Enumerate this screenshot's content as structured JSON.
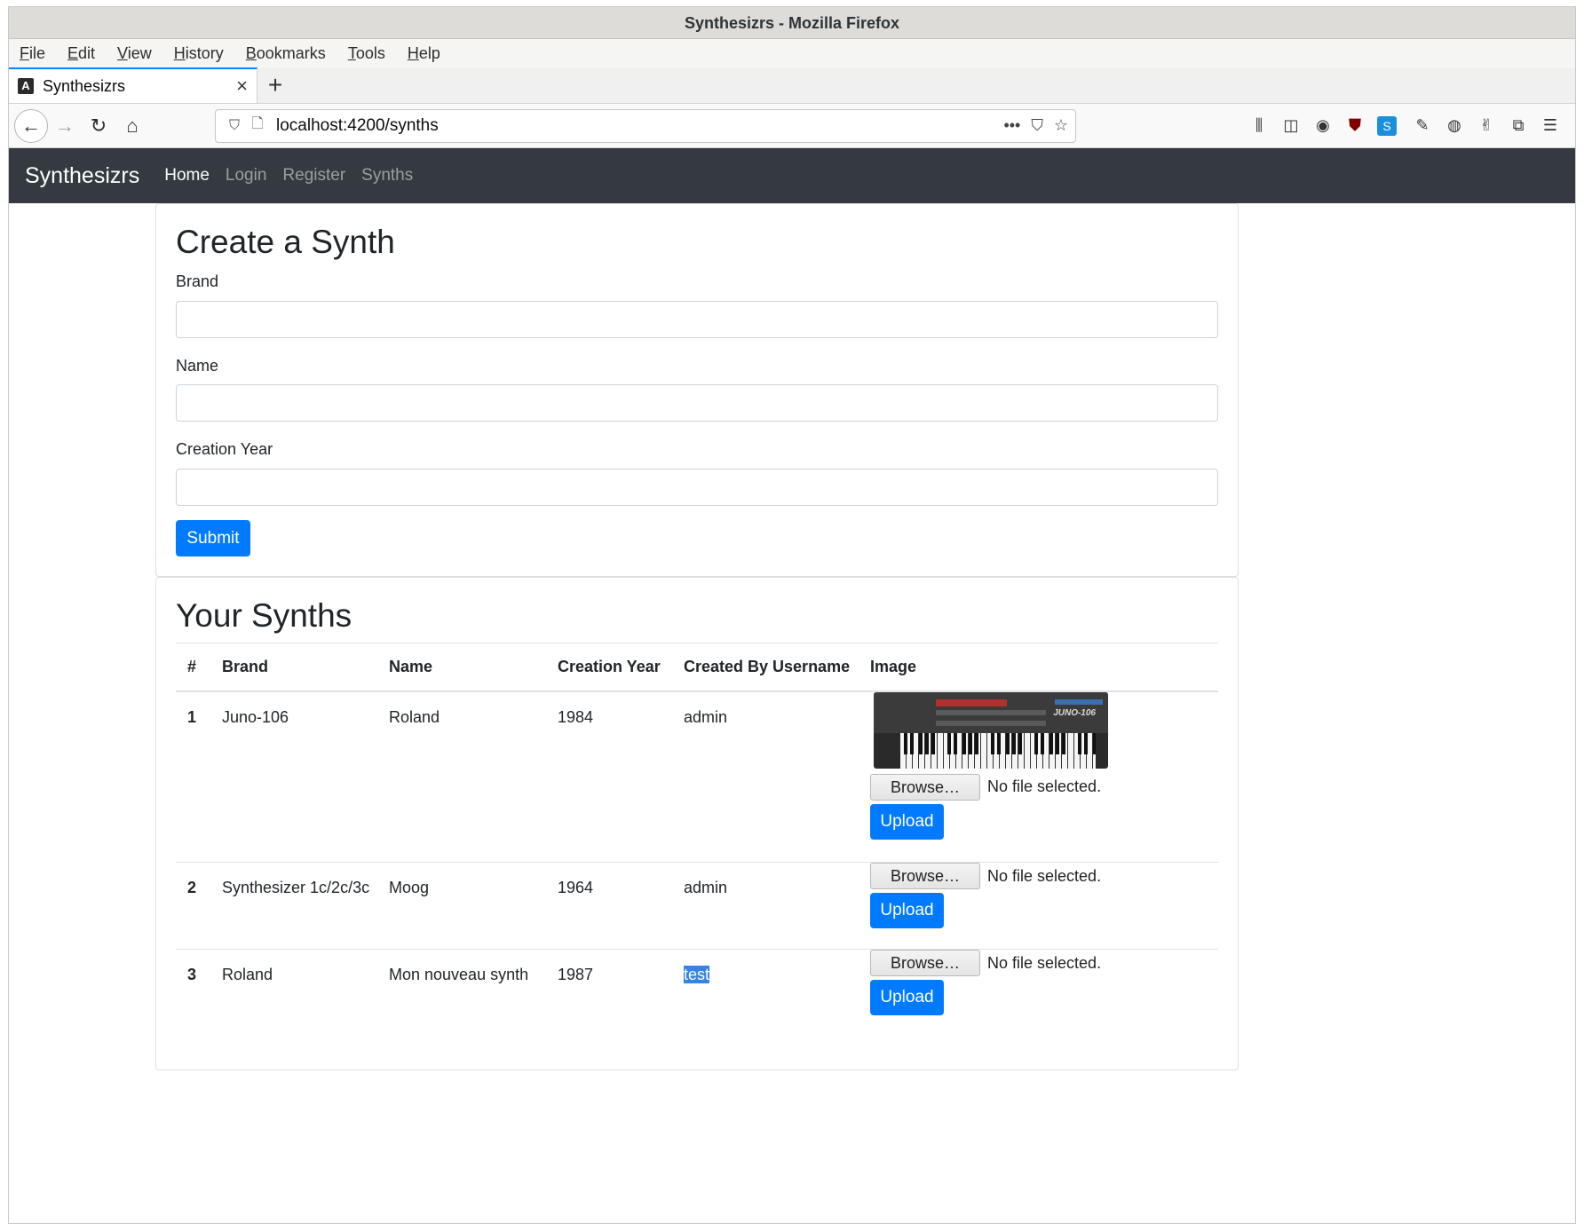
{
  "window": {
    "title": "Synthesizrs - Mozilla Firefox"
  },
  "menu": [
    {
      "label": "File",
      "accel": "F",
      "rest": "ile"
    },
    {
      "label": "Edit",
      "accel": "E",
      "rest": "dit"
    },
    {
      "label": "View",
      "accel": "V",
      "rest": "iew"
    },
    {
      "label": "History",
      "accel": "H",
      "rest": "istory"
    },
    {
      "label": "Bookmarks",
      "accel": "B",
      "rest": "ookmarks"
    },
    {
      "label": "Tools",
      "accel": "T",
      "rest": "ools"
    },
    {
      "label": "Help",
      "accel": "H",
      "rest": "elp"
    }
  ],
  "tab": {
    "title": "Synthesizrs",
    "favicon": "A",
    "close": "×",
    "new_tab": "+"
  },
  "browser": {
    "url": "localhost:4200/synths",
    "icons": {
      "back": "←",
      "forward": "→",
      "reload": "↻",
      "home": "⌂",
      "shield": "⛉",
      "page": "🗋",
      "more": "•••",
      "pocket": "⛉",
      "star": "☆",
      "library": "⫼",
      "sidebar": "◫",
      "account": "◉",
      "ublock": "⛊",
      "skype": "S",
      "ext1": "✎",
      "ext2": "◍",
      "ext3": "✌",
      "extensions": "⧉",
      "menu": "☰"
    }
  },
  "app_nav": {
    "brand": "Synthesizrs",
    "links": [
      {
        "label": "Home",
        "active": true
      },
      {
        "label": "Login",
        "active": false
      },
      {
        "label": "Register",
        "active": false
      },
      {
        "label": "Synths",
        "active": false
      }
    ]
  },
  "create_form": {
    "heading": "Create a Synth",
    "fields": [
      {
        "label": "Brand",
        "value": ""
      },
      {
        "label": "Name",
        "value": ""
      },
      {
        "label": "Creation Year",
        "value": ""
      }
    ],
    "submit_label": "Submit"
  },
  "synth_list": {
    "heading": "Your Synths",
    "columns": [
      "#",
      "Brand",
      "Name",
      "Creation Year",
      "Created By Username",
      "Image"
    ],
    "rows": [
      {
        "index": "1",
        "brand": "Juno-106",
        "name": "Roland",
        "year": "1984",
        "username": "admin",
        "has_image": true,
        "image_label": "JUNO-106",
        "browse": "Browse…",
        "file_status": "No file selected.",
        "upload": "Upload"
      },
      {
        "index": "2",
        "brand": "Synthesizer 1c/2c/3c",
        "name": "Moog",
        "year": "1964",
        "username": "admin",
        "has_image": false,
        "browse": "Browse…",
        "file_status": "No file selected.",
        "upload": "Upload"
      },
      {
        "index": "3",
        "brand": "Roland",
        "name": "Mon nouveau synth",
        "year": "1987",
        "username": "test",
        "has_image": false,
        "browse": "Browse…",
        "file_status": "No file selected.",
        "upload": "Upload"
      }
    ]
  },
  "colors": {
    "navbar": "#343a40",
    "primary": "#007bff",
    "selection": "#3584e4"
  }
}
